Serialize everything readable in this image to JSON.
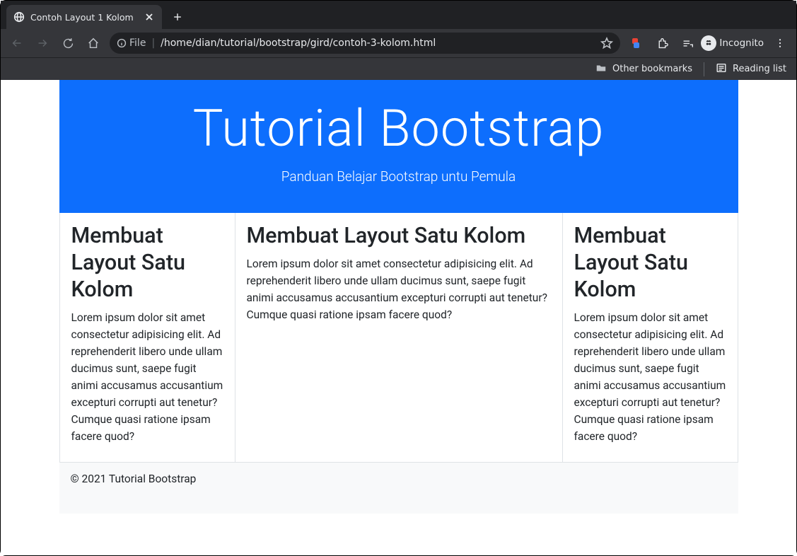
{
  "browser": {
    "tab_title": "Contoh Layout 1 Kolom",
    "url_scheme_label": "File",
    "url_path": "/home/dian/tutorial/bootstrap/gird/contoh-3-kolom.html",
    "incognito_label": "Incognito",
    "bookmarks": {
      "other": "Other bookmarks",
      "reading": "Reading list"
    }
  },
  "page": {
    "hero": {
      "title": "Tutorial Bootstrap",
      "subtitle": "Panduan Belajar Bootstrap untu Pemula"
    },
    "articles": [
      {
        "title": "Membuat Layout Satu Kolom",
        "body": "Lorem ipsum dolor sit amet consectetur adipisicing elit. Ad reprehenderit libero unde ullam ducimus sunt, saepe fugit animi accusamus accusantium excepturi corrupti aut tenetur? Cumque quasi ratione ipsam facere quod?"
      },
      {
        "title": "Membuat Layout Satu Kolom",
        "body": "Lorem ipsum dolor sit amet consectetur adipisicing elit. Ad reprehenderit libero unde ullam ducimus sunt, saepe fugit animi accusamus accusantium excepturi corrupti aut tenetur? Cumque quasi ratione ipsam facere quod?"
      },
      {
        "title": "Membuat Layout Satu Kolom",
        "body": "Lorem ipsum dolor sit amet consectetur adipisicing elit. Ad reprehenderit libero unde ullam ducimus sunt, saepe fugit animi accusamus accusantium excepturi corrupti aut tenetur? Cumque quasi ratione ipsam facere quod?"
      }
    ],
    "footer": "© 2021 Tutorial Bootstrap"
  }
}
